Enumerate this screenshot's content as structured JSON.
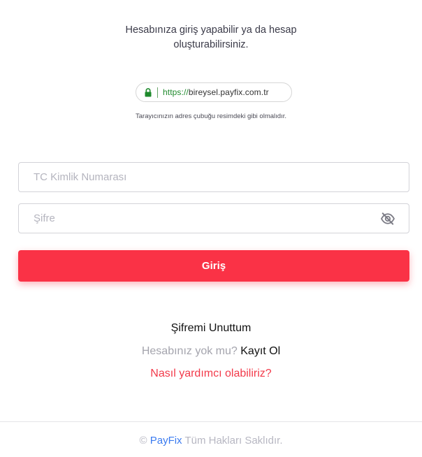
{
  "intro": {
    "line1": "Hesabınıza giriş yapabilir ya da hesap",
    "line2": "oluşturabilirsiniz."
  },
  "address_bar": {
    "protocol": "https://",
    "domain": "bireysel.payfix.com.tr",
    "lock_icon": "lock-icon",
    "lock_color": "#1e8a2c"
  },
  "hint": "Tarayıcınızın adres çubuğu resimdeki gibi olmalıdır.",
  "form": {
    "tc_placeholder": "TC Kimlik Numarası",
    "tc_value": "",
    "password_placeholder": "Şifre",
    "password_value": "",
    "password_toggle_icon": "eye-slash-icon",
    "submit_label": "Giriş"
  },
  "links": {
    "forgot": "Şifremi Unuttum",
    "no_account_text": "Hesabınız yok mu?",
    "register": "Kayıt Ol",
    "help": "Nasıl yardımcı olabiliriz?"
  },
  "footer": {
    "copyright_symbol": "©",
    "brand": "PayFix",
    "rights": "Tüm Hakları Saklıdır."
  },
  "colors": {
    "accent": "#fa3246",
    "brand": "#3b7bf0",
    "help_link": "#f23a4a"
  }
}
